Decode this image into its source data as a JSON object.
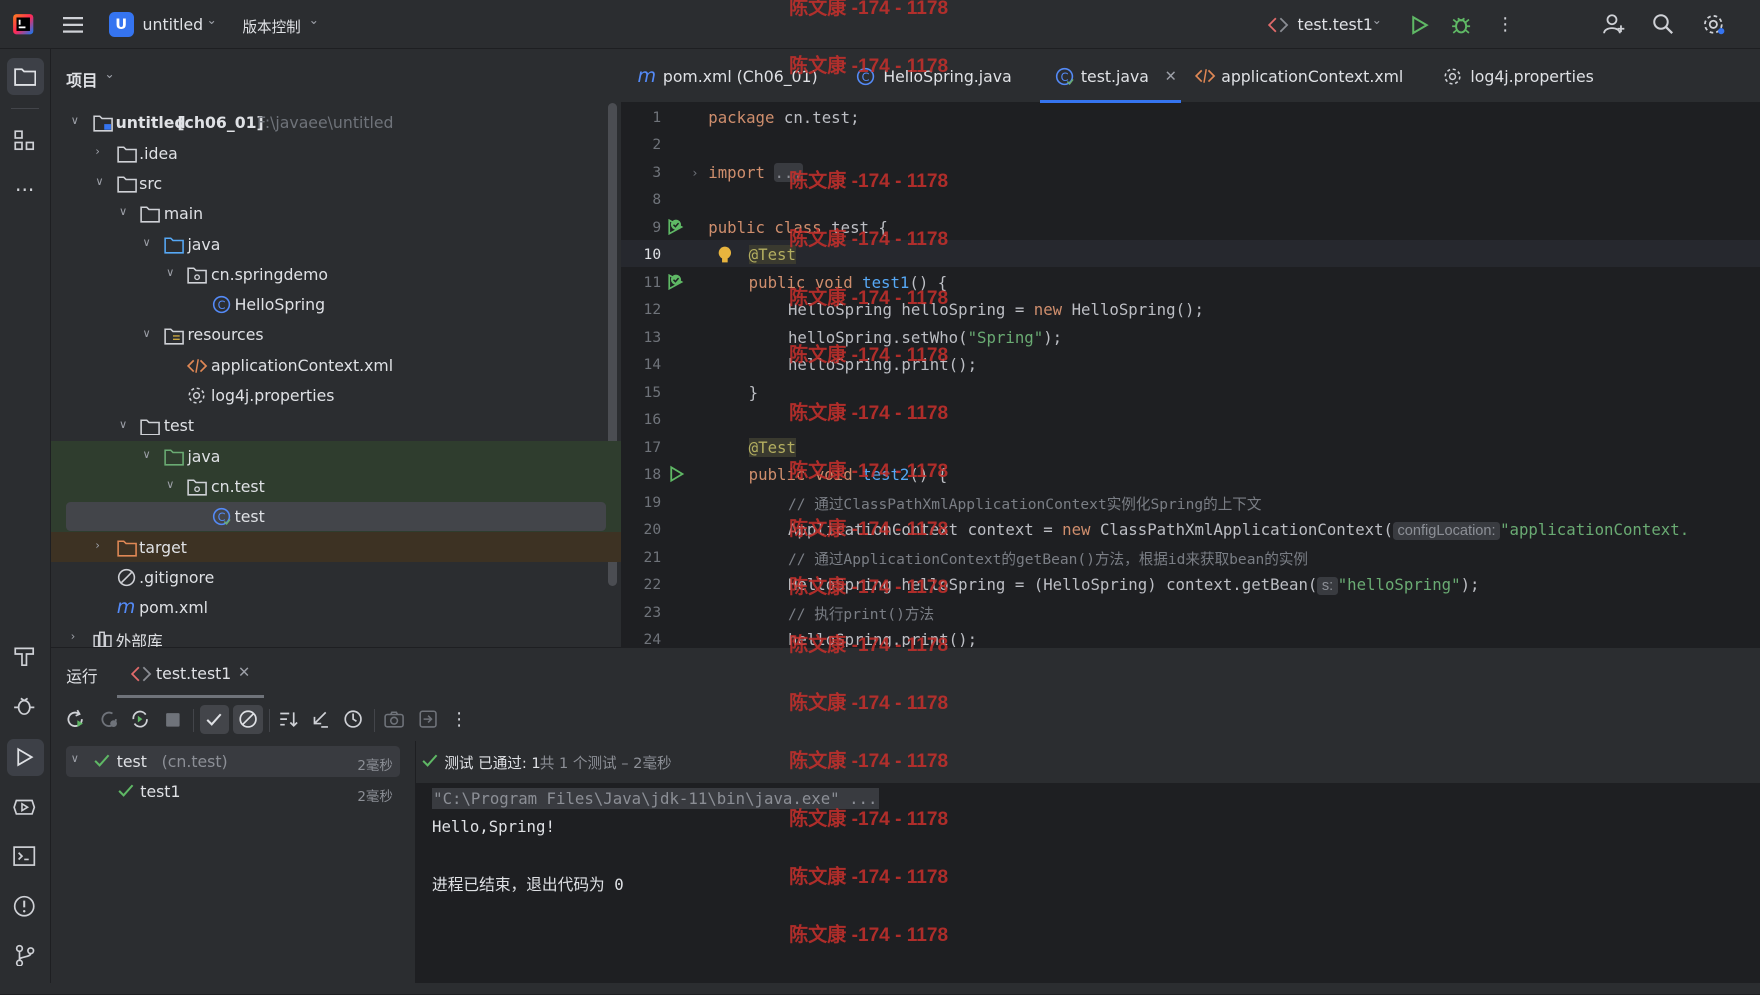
{
  "header": {
    "project_letter": "U",
    "project_name": "untitled",
    "vcs": "版本控制",
    "run_config": "test.test1"
  },
  "project_panel": {
    "title": "项目",
    "tree": [
      {
        "label": "untitled",
        "suffix": "[ch06_01]",
        "path": "F:\\javaee\\untitled"
      },
      {
        "label": ".idea"
      },
      {
        "label": "src"
      },
      {
        "label": "main"
      },
      {
        "label": "java"
      },
      {
        "label": "cn.springdemo"
      },
      {
        "label": "HelloSpring"
      },
      {
        "label": "resources"
      },
      {
        "label": "applicationContext.xml"
      },
      {
        "label": "log4j.properties"
      },
      {
        "label": "test"
      },
      {
        "label": "java"
      },
      {
        "label": "cn.test"
      },
      {
        "label": "test"
      },
      {
        "label": "target"
      },
      {
        "label": ".gitignore"
      },
      {
        "label": "pom.xml"
      },
      {
        "label": "外部库"
      }
    ]
  },
  "tabs": [
    {
      "label": "pom.xml (Ch06_01)"
    },
    {
      "label": "HelloSpring.java"
    },
    {
      "label": "test.java"
    },
    {
      "label": "applicationContext.xml"
    },
    {
      "label": "log4j.properties"
    }
  ],
  "editor": {
    "line_numbers": [
      "1",
      "2",
      "3",
      "8",
      "9",
      "10",
      "11",
      "12",
      "13",
      "14",
      "15",
      "16",
      "17",
      "18",
      "19",
      "20",
      "21",
      "22",
      "23",
      "24"
    ],
    "lines": {
      "l1_kw": "package ",
      "l1_rest": "cn.test;",
      "l3_kw": "import ",
      "l3_rest": "...",
      "l9_kw": "public class ",
      "l9_rest": "test {",
      "l10": "@Test",
      "l11_kw": "public void ",
      "l11_fn": "test1",
      "l11_rest": "() {",
      "l12_a": "HelloSpring helloSpring = ",
      "l12_kw": "new ",
      "l12_b": "HelloSpring();",
      "l13_a": "helloSpring.setWho(",
      "l13_str": "\"Spring\"",
      "l13_b": ");",
      "l14": "helloSpring.print();",
      "l15": "}",
      "l17": "@Test",
      "l18_kw": "public void ",
      "l18_fn": "test2",
      "l18_rest": "() {",
      "l19": "// 通过ClassPathXmlApplicationContext实例化Spring的上下文",
      "l20_a": "ApplicationContext context = ",
      "l20_kw": "new ",
      "l20_b": "ClassPathXmlApplicationContext(",
      "l20_hint": "configLocation:",
      "l20_str": "\"applicationContext.",
      "l21": "// 通过ApplicationContext的getBean()方法，根据id来获取bean的实例",
      "l22_a": "HelloSpring helloSpring = (HelloSpring) context.getBean(",
      "l22_hint": "s:",
      "l22_str": "\"helloSpring\"",
      "l22_b": ");",
      "l23": "// 执行print()方法",
      "l24": "helloSpring.print();"
    }
  },
  "run_panel": {
    "title": "运行",
    "tab": "test.test1",
    "tree": [
      {
        "label": "test",
        "pkg": "(cn.test)",
        "time": "2毫秒"
      },
      {
        "label": "test1",
        "time": "2毫秒"
      }
    ],
    "status_prefix": "测试 已通过: ",
    "status_count": "1",
    "status_suffix": "共 1 个测试 – 2毫秒",
    "console": {
      "cmd": "\"C:\\Program Files\\Java\\jdk-11\\bin\\java.exe\" ...",
      "out": "Hello,Spring!",
      "exit": "进程已结束，退出代码为 0"
    }
  },
  "watermark": "陈文康 -174 - 1178",
  "colors": {
    "accent": "#3574f0",
    "green": "#5fb865",
    "watermark": "#c9302c"
  }
}
